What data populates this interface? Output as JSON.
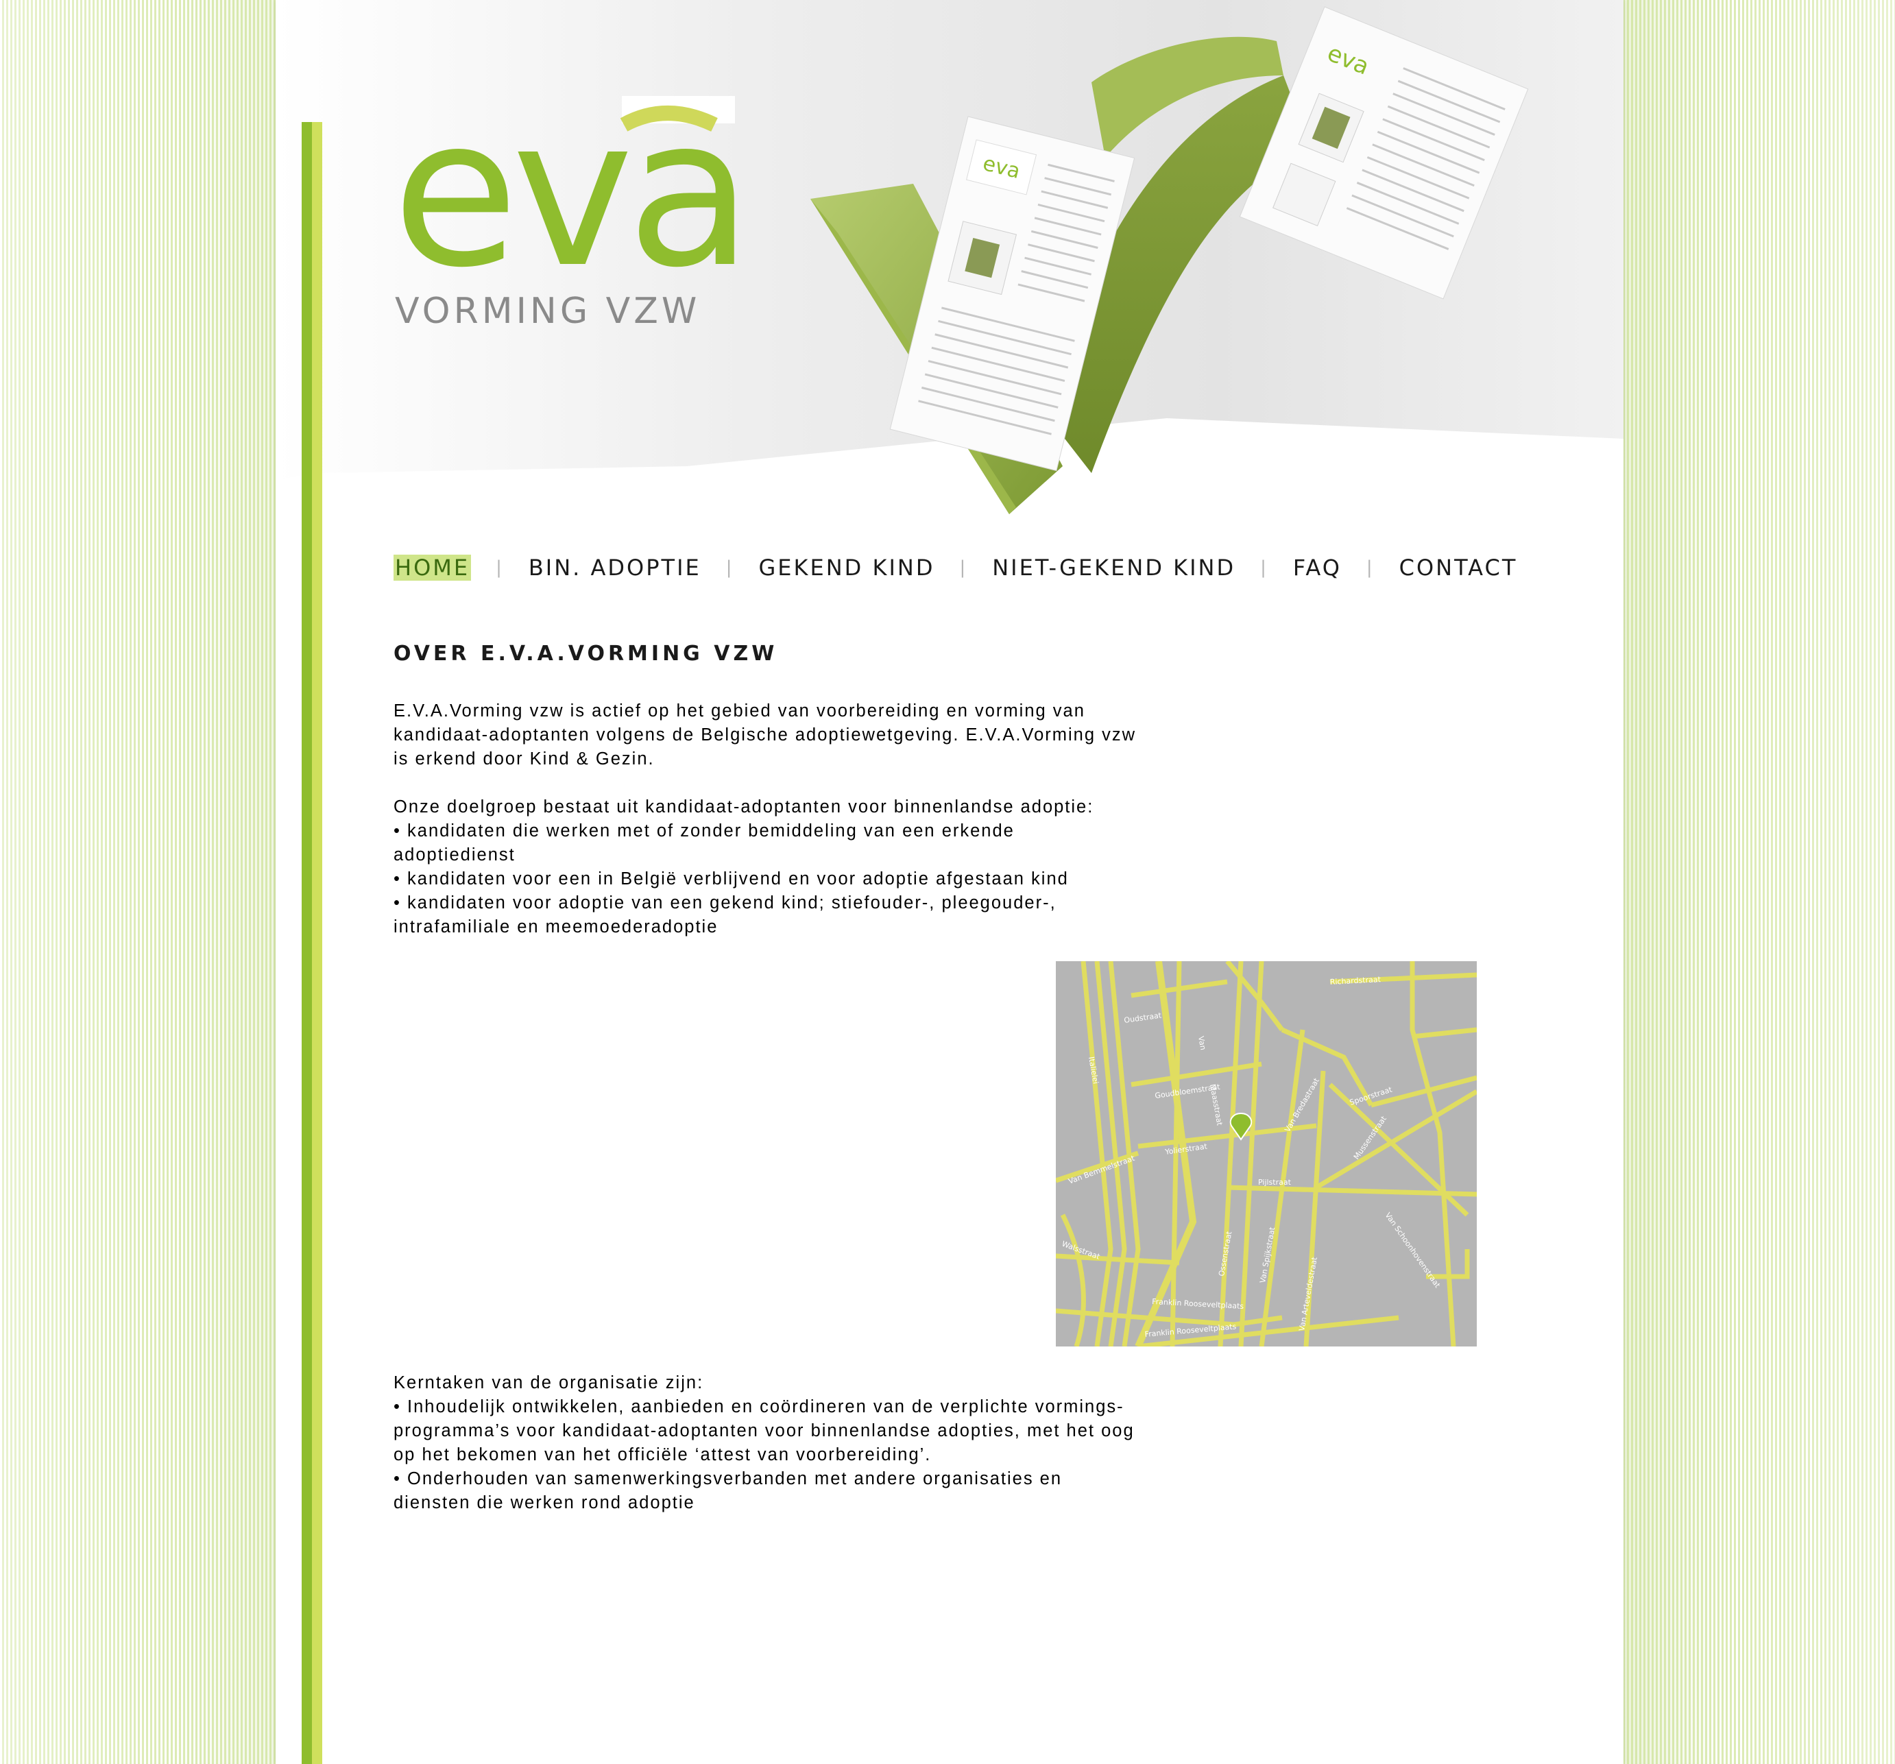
{
  "brand": {
    "logo_text": "eva",
    "logo_sub": "VORMING VZW",
    "colors": {
      "green": "#8fbd2e",
      "lime": "#cfd85a",
      "grey": "#8a8a8a",
      "map_bg": "#b5b5b5",
      "map_road": "#e0dd60"
    }
  },
  "nav": {
    "items": [
      {
        "label": "HOME",
        "active": true
      },
      {
        "label": "BIN. ADOPTIE"
      },
      {
        "label": "GEKEND KIND"
      },
      {
        "label": "NIET-GEKEND KIND"
      },
      {
        "label": "FAQ"
      },
      {
        "label": "CONTACT"
      }
    ],
    "separator": "|"
  },
  "content": {
    "title": "OVER E.V.A.VORMING VZW",
    "p1": "E.V.A.Vorming vzw is actief op het gebied van voorbereiding en vorming van\nkandidaat-adoptanten volgens de Belgische adoptiewetgeving. E.V.A.Vorming vzw\nis erkend door Kind & Gezin.",
    "p2": "Onze doelgroep bestaat uit kandidaat-adoptanten voor binnenlandse adoptie:\n• kandidaten die werken met of zonder bemiddeling van een erkende\nadoptiedienst\n• kandidaten voor een in België verblijvend en voor adoptie afgestaan kind\n• kandidaten voor adoptie van een gekend kind; stiefouder-, pleegouder-,\nintrafamiliale en meemoederadoptie",
    "p3": "Kerntaken van de organisatie zijn:\n• Inhoudelijk ontwikkelen, aanbieden en coördineren van de verplichte vormings-\nprogramma’s voor kandidaat-adoptanten voor binnenlandse adopties, met het oog\nop het bekomen van het officiële ‘attest van voorbereiding’.\n• Onderhouden van samenwerkingsverbanden met andere organisaties en\ndiensten die werken rond adoptie"
  },
  "map": {
    "streets": [
      "Richardstraat",
      "Oudstraat",
      "Van",
      "Maasstraat",
      "Goudbloemstraat",
      "Yolierstraat",
      "Italielei",
      "Van Bemmelstraat",
      "Walsstraat",
      "Pijlstraat",
      "Spoorstraat",
      "Mussenstraat",
      "Van Schoonhovenstraat",
      "Van Bredastraat",
      "Ossenstraat",
      "Van Spijkstraat",
      "Van Arteveldestraat",
      "Franklin Rooseveltplaats"
    ]
  }
}
